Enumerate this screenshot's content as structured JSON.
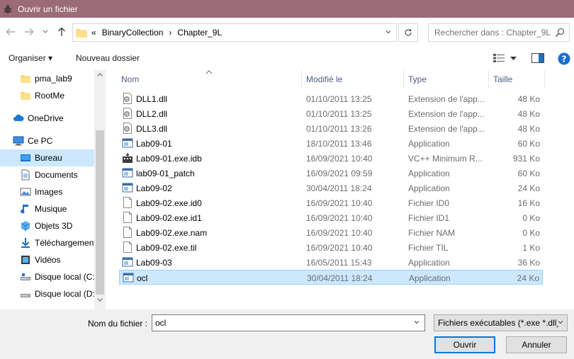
{
  "window": {
    "title": "Ouvrir un fichier"
  },
  "address": {
    "crumbs": [
      "«",
      "BinaryCollection",
      "›",
      "Chapter_9L"
    ]
  },
  "search": {
    "placeholder": "Rechercher dans : Chapter_9L"
  },
  "toolbar": {
    "organize_label": "Organiser ▾",
    "new_folder_label": "Nouveau dossier"
  },
  "sidebar": {
    "items": [
      {
        "label": "pma_lab9",
        "icon": "folder-icon"
      },
      {
        "label": "RootMe",
        "icon": "folder-icon"
      },
      {
        "label": "OneDrive",
        "icon": "cloud-icon"
      },
      {
        "label": "Ce PC",
        "icon": "computer-icon"
      },
      {
        "label": "Bureau",
        "icon": "desktop-icon"
      },
      {
        "label": "Documents",
        "icon": "documents-icon"
      },
      {
        "label": "Images",
        "icon": "images-icon"
      },
      {
        "label": "Musique",
        "icon": "music-icon"
      },
      {
        "label": "Objets 3D",
        "icon": "cube-icon"
      },
      {
        "label": "Téléchargements",
        "icon": "download-icon"
      },
      {
        "label": "Vidéos",
        "icon": "video-icon"
      },
      {
        "label": "Disque local (C:)",
        "icon": "drive-icon"
      },
      {
        "label": "Disque local (D:)",
        "icon": "drive-icon"
      }
    ]
  },
  "columns": {
    "name": "Nom",
    "modified": "Modifié le",
    "type": "Type",
    "size": "Taille"
  },
  "files": [
    {
      "name": "DLL1.dll",
      "modified": "01/10/2011 13:25",
      "type": "Extension de l'app...",
      "size": "48 Ko",
      "icon": "dll"
    },
    {
      "name": "DLL2.dll",
      "modified": "01/10/2011 13:25",
      "type": "Extension de l'app...",
      "size": "48 Ko",
      "icon": "dll"
    },
    {
      "name": "DLL3.dll",
      "modified": "01/10/2011 13:26",
      "type": "Extension de l'app...",
      "size": "48 Ko",
      "icon": "dll"
    },
    {
      "name": "Lab09-01",
      "modified": "18/10/2011 13:46",
      "type": "Application",
      "size": "60 Ko",
      "icon": "exe"
    },
    {
      "name": "Lab09-01.exe.idb",
      "modified": "16/09/2021 10:40",
      "type": "VC++ Minimum R...",
      "size": "931 Ko",
      "icon": "idb"
    },
    {
      "name": "lab09-01_patch",
      "modified": "16/09/2021 09:59",
      "type": "Application",
      "size": "60 Ko",
      "icon": "exe"
    },
    {
      "name": "Lab09-02",
      "modified": "30/04/2011 18:24",
      "type": "Application",
      "size": "24 Ko",
      "icon": "exe"
    },
    {
      "name": "Lab09-02.exe.id0",
      "modified": "16/09/2021 10:40",
      "type": "Fichier ID0",
      "size": "16 Ko",
      "icon": "file"
    },
    {
      "name": "Lab09-02.exe.id1",
      "modified": "16/09/2021 10:40",
      "type": "Fichier ID1",
      "size": "0 Ko",
      "icon": "file"
    },
    {
      "name": "Lab09-02.exe.nam",
      "modified": "16/09/2021 10:40",
      "type": "Fichier NAM",
      "size": "0 Ko",
      "icon": "file"
    },
    {
      "name": "Lab09-02.exe.til",
      "modified": "16/09/2021 10:40",
      "type": "Fichier TIL",
      "size": "1 Ko",
      "icon": "file"
    },
    {
      "name": "Lab09-03",
      "modified": "16/05/2011 15:43",
      "type": "Application",
      "size": "36 Ko",
      "icon": "exe"
    },
    {
      "name": "ocl",
      "modified": "30/04/2011 18:24",
      "type": "Application",
      "size": "24 Ko",
      "icon": "exe"
    }
  ],
  "footer": {
    "filename_label": "Nom du fichier :",
    "filename_value": "ocl",
    "filter_value": "Fichiers exécutables (*.exe *.dll)",
    "open_label": "Ouvrir",
    "cancel_label": "Annuler"
  },
  "colors": {
    "title_bar": "#9b6b77",
    "selection": "#cce8ff",
    "accent": "#0078d7"
  }
}
